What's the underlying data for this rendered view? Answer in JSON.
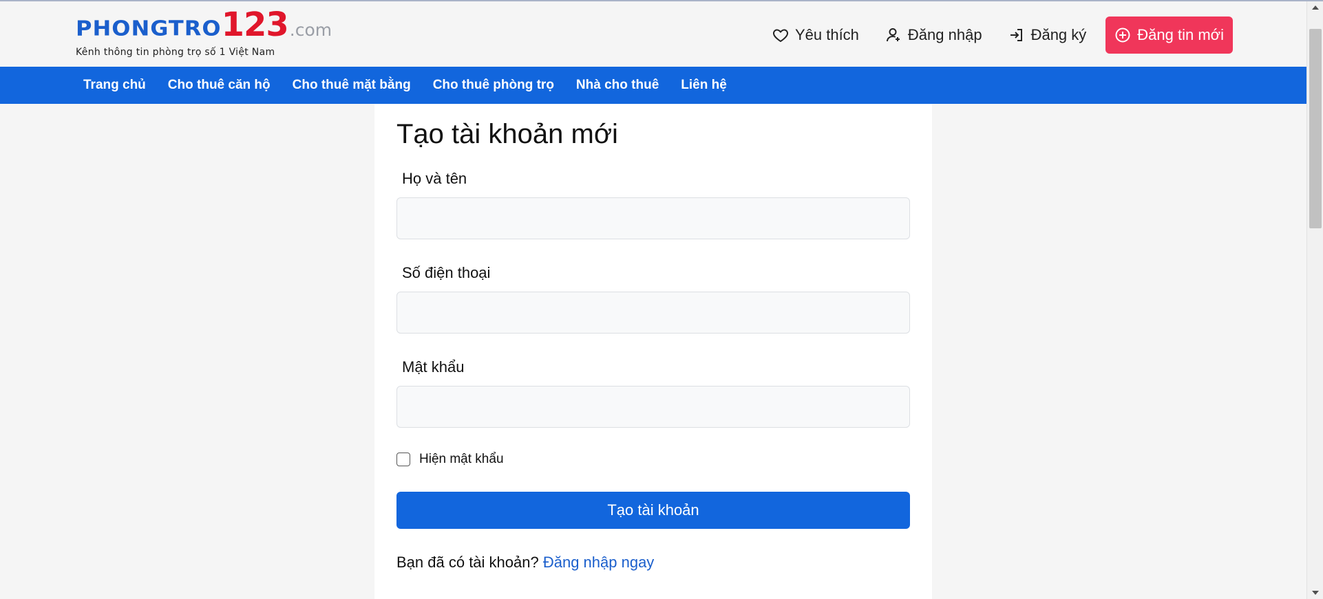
{
  "logo": {
    "brand": "PHONGTRO",
    "number": "123",
    "domain": ".com",
    "tagline": "Kênh thông tin phòng trọ số 1 Việt Nam"
  },
  "header": {
    "favorites": "Yêu thích",
    "login": "Đăng nhập",
    "register": "Đăng ký",
    "post_new": "Đăng tin mới"
  },
  "nav": {
    "items": [
      "Trang chủ",
      "Cho thuê căn hộ",
      "Cho thuê mặt bằng",
      "Cho thuê phòng trọ",
      "Nhà cho thuê",
      "Liên hệ"
    ]
  },
  "form": {
    "title": "Tạo tài khoản mới",
    "fullname_label": "Họ và tên",
    "fullname_value": "",
    "phone_label": "Số điện thoại",
    "phone_value": "",
    "password_label": "Mật khẩu",
    "password_value": "",
    "show_password_label": "Hiện mật khẩu",
    "show_password_checked": false,
    "submit_label": "Tạo tài khoản",
    "have_account_text": "Bạn đã có tài khoản?",
    "login_now_link": "Đăng nhập ngay"
  },
  "colors": {
    "brand_blue": "#1266dd",
    "brand_red": "#e0162b",
    "post_button": "#f0365a",
    "link_blue": "#1b5fcc"
  },
  "icons": {
    "favorites": "heart-icon",
    "login": "user-icon",
    "register": "sign-in-icon",
    "post_new": "plus-circle-icon"
  }
}
